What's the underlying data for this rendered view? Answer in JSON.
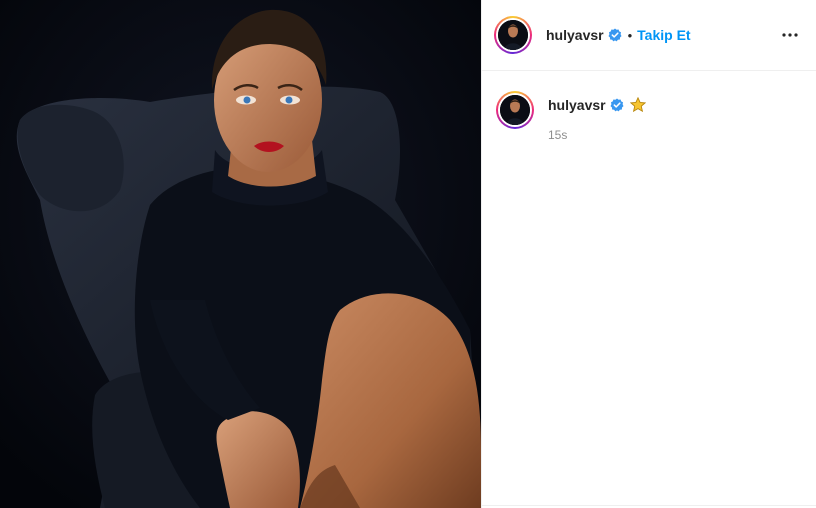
{
  "post": {
    "author": {
      "username": "hulyavsr",
      "verified": true,
      "avatar_icon": "profile-photo-icon"
    },
    "header": {
      "separator": "•",
      "follow_label": "Takip Et",
      "more_icon": "more-options-icon"
    },
    "caption": {
      "username": "hulyavsr",
      "emoji": "⭐",
      "timestamp": "15s"
    },
    "colors": {
      "follow_blue": "#0095f6",
      "verified_blue": "#3897f0",
      "text_dark": "#262626",
      "text_muted": "#8e8e8e",
      "photo_background": "#05070d"
    }
  }
}
